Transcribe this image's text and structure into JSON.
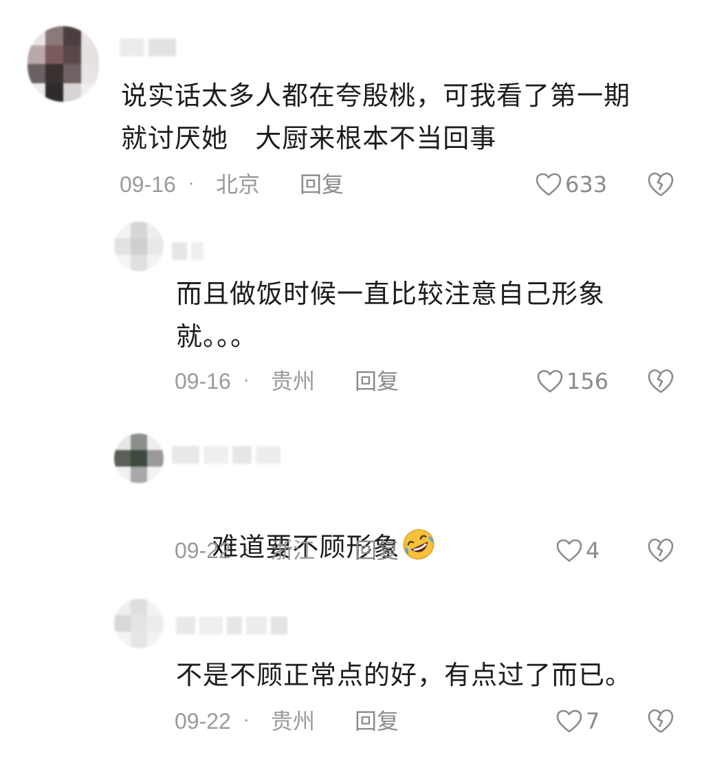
{
  "comments": [
    {
      "text": "说实话太多人都在夸殷桃，可我看了第一期\n就讨厌她   大厨来根本不当回事",
      "date": "09-16",
      "location": "北京",
      "reply_label": "回复",
      "likes": "633"
    },
    {
      "text": "而且做饭时候一直比较注意自己形象\n就。。。",
      "date": "09-16",
      "location": "贵州",
      "reply_label": "回复",
      "likes": "156"
    },
    {
      "text": "难道要不顾形象",
      "emoji": "rolling-on-floor-laughing-emoji",
      "date": "09-22",
      "location": "浙江",
      "reply_label": "回复",
      "likes": "4"
    },
    {
      "text": "不是不顾正常点的好，有点过了而已。",
      "date": "09-22",
      "location": "贵州",
      "reply_label": "回复",
      "likes": "7"
    }
  ],
  "separator": "·",
  "icons": {
    "like": "heart-outline-icon",
    "dislike": "broken-heart-icon"
  },
  "colors": {
    "text": "#1c1c1c",
    "meta": "#9a9a9a",
    "icon": "#8a8a8a",
    "background": "#ffffff"
  }
}
